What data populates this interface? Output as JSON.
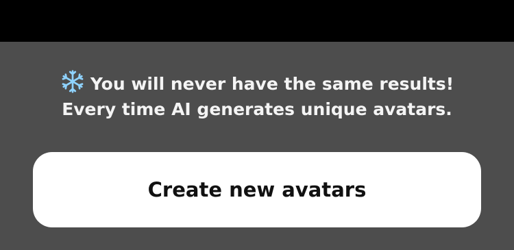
{
  "info": {
    "icon": "snowflake-icon",
    "line1": "You will never have the same results!",
    "line2": "Every time AI generates unique avatars."
  },
  "action": {
    "label": "Create new avatars"
  },
  "colors": {
    "top_bar": "#000000",
    "background": "#4d4d4d",
    "text": "#f4f4f4",
    "button_bg": "#ffffff",
    "button_text": "#111111",
    "icon": "#8fd3ff"
  }
}
